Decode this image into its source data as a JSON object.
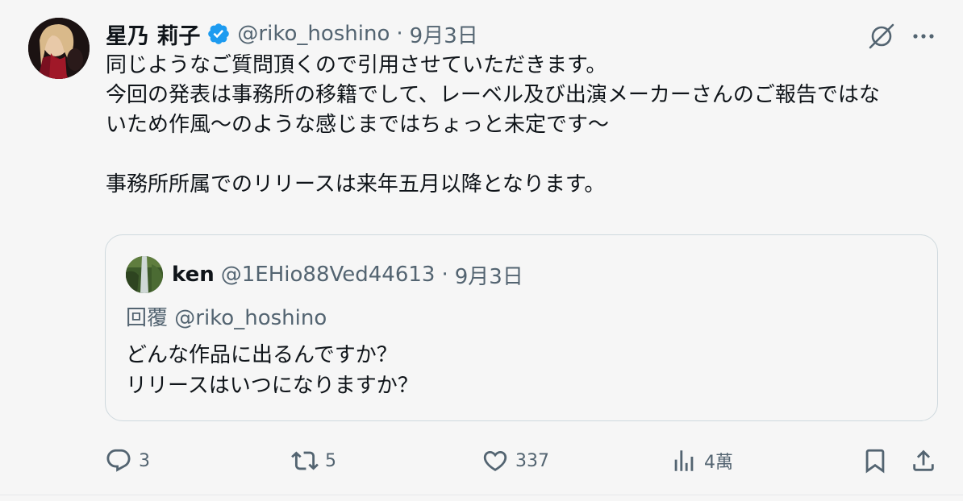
{
  "author": {
    "display_name": "星乃 莉子",
    "handle": "@riko_hoshino",
    "separator": "·",
    "date": "9月3日",
    "verified_icon": "verified-badge-icon"
  },
  "tweet": {
    "lines": [
      "同じようなご質問頂くので引用させていただきます。",
      "今回の発表は事務所の移籍でして、レーベル及び出演メーカーさんのご報告ではな",
      "いため作風〜のような感じまではちょっと未定です〜",
      "",
      "事務所所属でのリリースは来年五月以降となります。"
    ]
  },
  "quote": {
    "display_name": "ken",
    "handle": "@1EHio88Ved44613",
    "separator": "·",
    "date": "9月3日",
    "reply_to": "回覆 @riko_hoshino",
    "lines": [
      "どんな作品に出るんですか？",
      "リリースはいつになりますか？"
    ]
  },
  "actions": {
    "reply_count": "3",
    "retweet_count": "5",
    "like_count": "337",
    "view_count": "4萬"
  },
  "colors": {
    "background": "#f6f6f6",
    "text_primary": "#0f1419",
    "text_secondary": "#536471",
    "verified_blue": "#1d9bf0",
    "border": "#cfd9de"
  }
}
